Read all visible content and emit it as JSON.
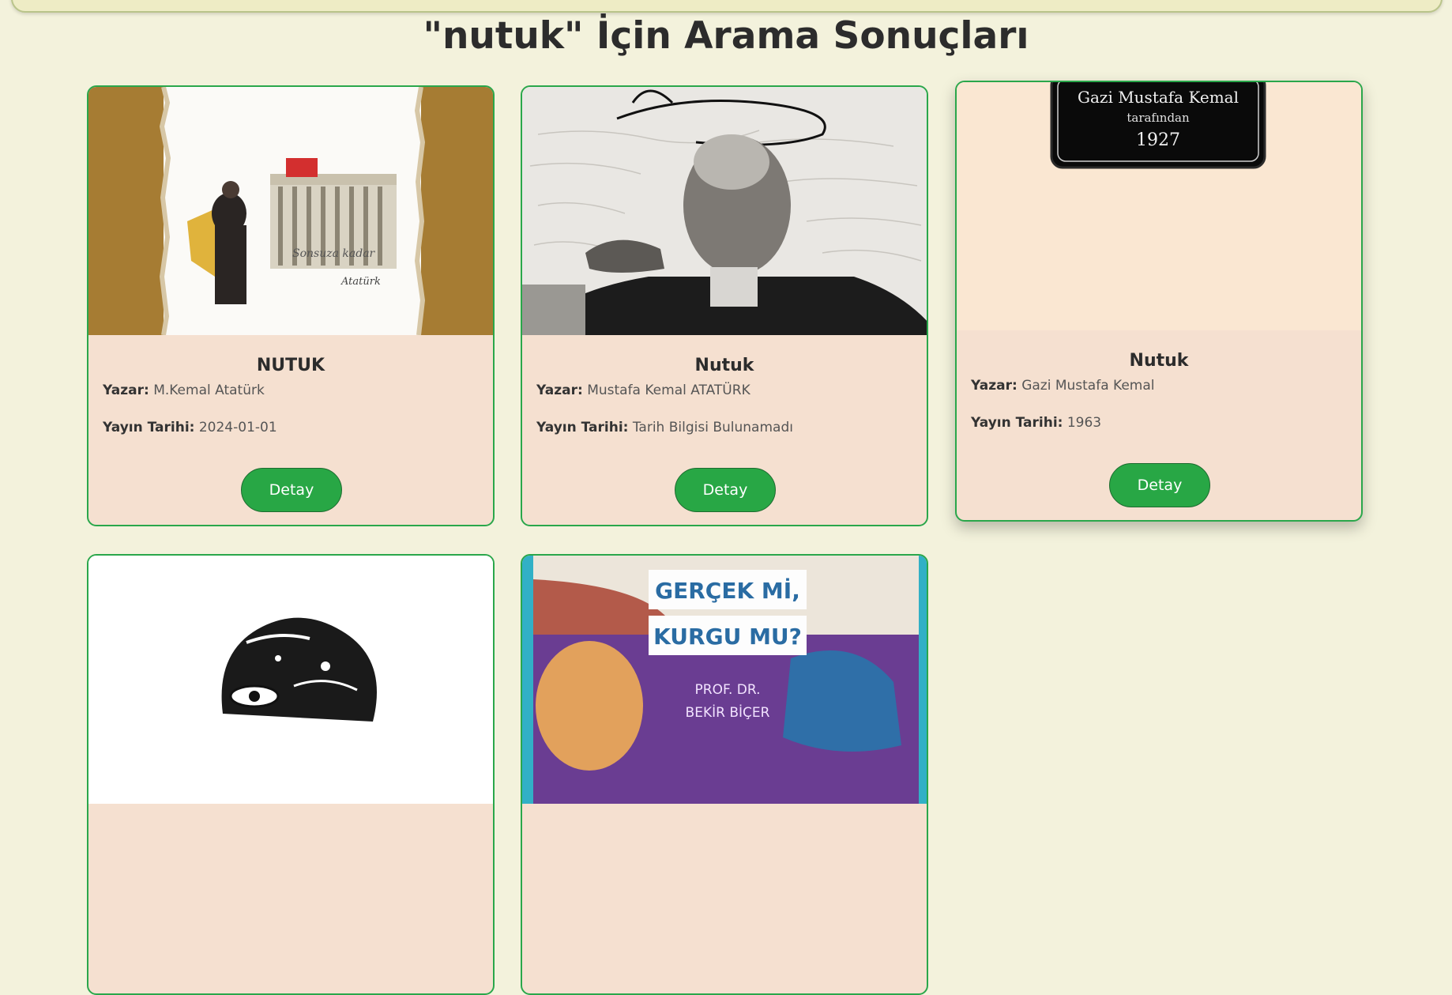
{
  "page": {
    "title": "\"nutuk\" İçin Arama Sonuçları"
  },
  "labels": {
    "author": "Yazar:",
    "date": "Yayın Tarihi:",
    "button": "Detay"
  },
  "books": [
    {
      "title": "NUTUK",
      "author": "M.Kemal Atatürk",
      "date": "2024-01-01",
      "cover_text": [
        "Sonsuza kadar",
        "Atatürk"
      ]
    },
    {
      "title": "Nutuk",
      "author": "Mustafa Kemal ATATÜRK",
      "date": "Tarih Bilgisi Bulunamadı"
    },
    {
      "title": "Nutuk",
      "author": "Gazi Mustafa Kemal",
      "date": "1963",
      "cover_text": [
        "Gazi Mustafa Kemal",
        "tarafından",
        "1927"
      ]
    },
    {
      "title": ""
    },
    {
      "title": "",
      "cover_text": [
        "GERÇEK Mİ,",
        "KURGU MU?",
        "PROF. DR.",
        "BEKİR BİÇER"
      ]
    }
  ],
  "colors": {
    "background": "#f3f2dc",
    "card_border": "#2aa74b",
    "card_body": "#f5e0d0",
    "button": "#28a745"
  }
}
